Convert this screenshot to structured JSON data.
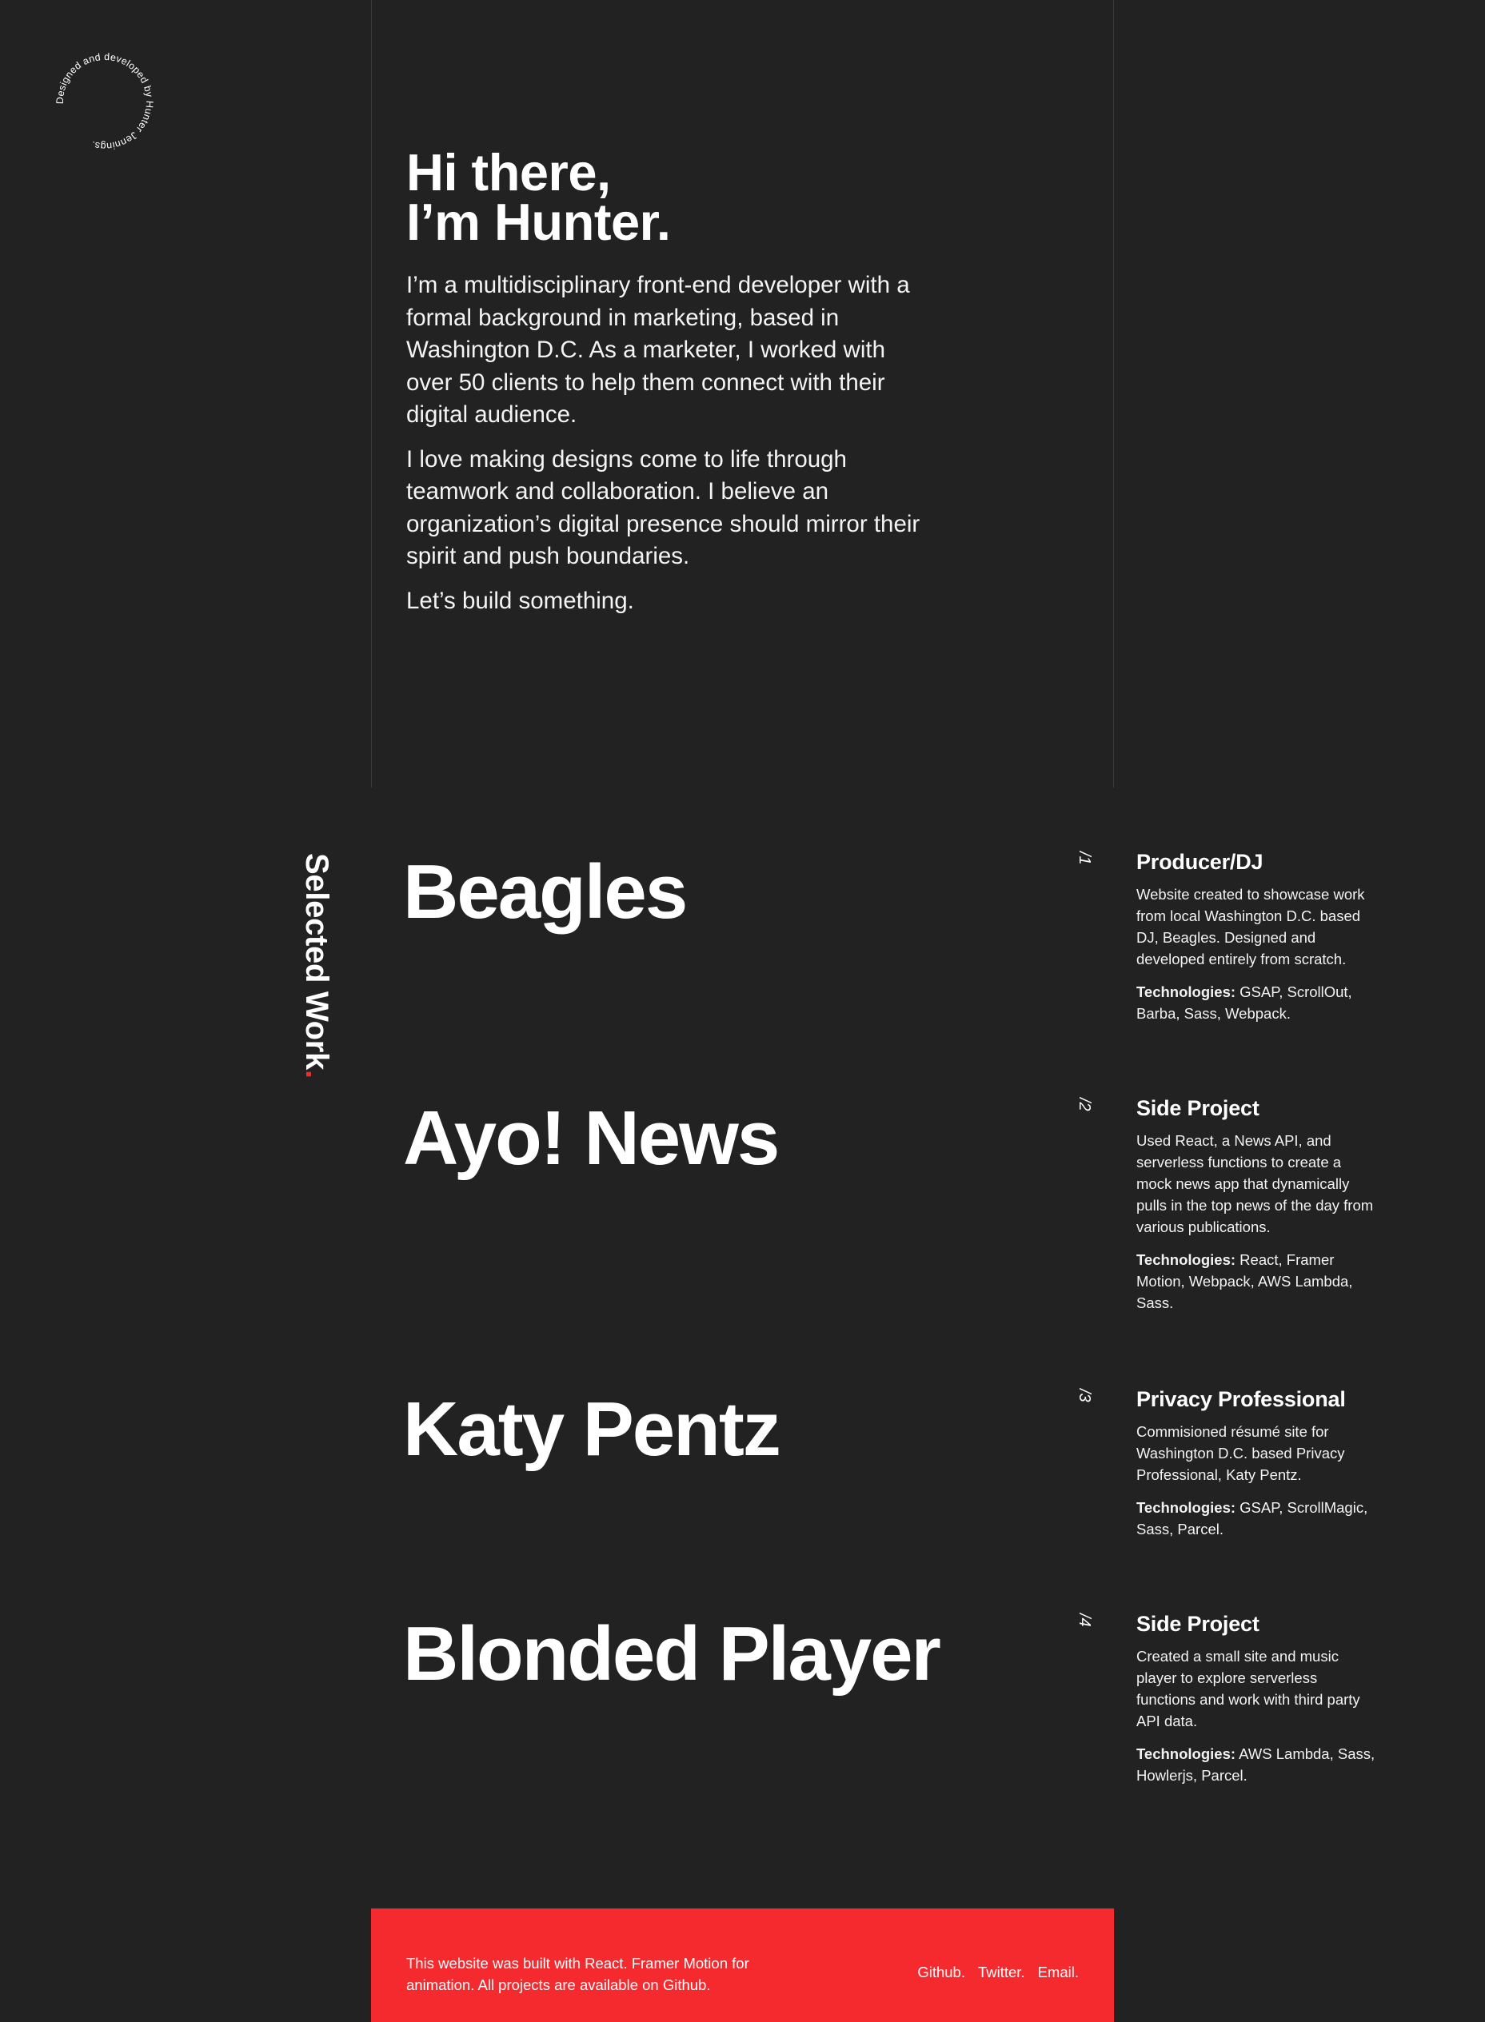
{
  "badge": {
    "text": "Designed and developed by Hunter Jennings."
  },
  "hero": {
    "greeting_line1": "Hi there,",
    "greeting_line2": "I’m Hunter.",
    "paragraphs": [
      "I’m a multidisciplinary front-end developer with a formal background in marketing, based in Washington D.C. As a marketer, I worked with over 50 clients to help them connect with their digital audience.",
      "I love making designs come to life through teamwork and collaboration. I believe an organization’s digital presence should mirror their spirit and push boundaries.",
      "Let’s build something."
    ]
  },
  "selected_work": {
    "label": "Selected Work",
    "dot": ".",
    "tech_label": "Technologies:",
    "projects": [
      {
        "title": "Beagles",
        "number": "/1",
        "category": "Producer/DJ",
        "description": "Website created to showcase work from local Washington D.C. based DJ, Beagles. Designed and developed entirely from scratch.",
        "technologies": " GSAP, ScrollOut, Barba, Sass, Webpack."
      },
      {
        "title": "Ayo! News",
        "number": "/2",
        "category": "Side Project",
        "description": "Used React, a News API, and serverless functions to create a mock news app that dynamically pulls in the top news of the day from various publications.",
        "technologies": " React, Framer Motion, Webpack, AWS Lambda, Sass."
      },
      {
        "title": "Katy Pentz",
        "number": "/3",
        "category": "Privacy Professional",
        "description": "Commisioned résumé site for Washington D.C. based Privacy Professional, Katy Pentz.",
        "technologies": " GSAP, ScrollMagic, Sass, Parcel."
      },
      {
        "title": "Blonded Player",
        "number": "/4",
        "category": "Side Project",
        "description": "Created a small site and music player to explore serverless functions and work with third party API data.",
        "technologies": " AWS Lambda, Sass, Howlerjs, Parcel."
      }
    ]
  },
  "footer": {
    "text": "This website was built with React. Framer Motion for animation. All projects are available on Github.",
    "links": [
      "Github.",
      "Twitter.",
      "Email."
    ]
  },
  "colors": {
    "background": "#222222",
    "accent": "#f52a2f",
    "text": "#ffffff"
  }
}
